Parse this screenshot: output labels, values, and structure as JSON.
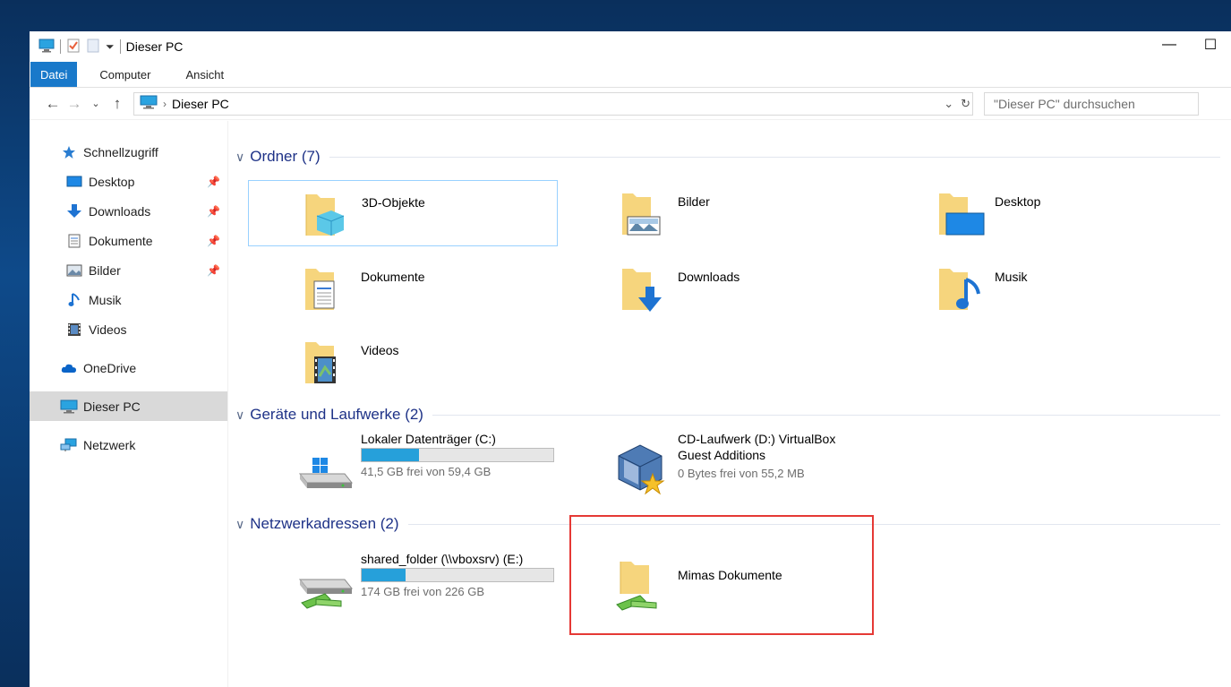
{
  "window": {
    "title": "Dieser PC",
    "controls": [
      "minimize",
      "maximize"
    ]
  },
  "ribbon": {
    "tabs": [
      {
        "label": "Datei"
      },
      {
        "label": "Computer"
      },
      {
        "label": "Ansicht"
      }
    ]
  },
  "address": {
    "crumb": "Dieser PC",
    "search_placeholder": "\"Dieser PC\" durchsuchen"
  },
  "sidebar": {
    "quick_access": "Schnellzugriff",
    "items": [
      {
        "label": "Desktop",
        "icon": "desktop-icon",
        "pinned": true
      },
      {
        "label": "Downloads",
        "icon": "download-icon",
        "pinned": true
      },
      {
        "label": "Dokumente",
        "icon": "document-icon",
        "pinned": true
      },
      {
        "label": "Bilder",
        "icon": "image-icon",
        "pinned": true
      },
      {
        "label": "Musik",
        "icon": "music-icon",
        "pinned": false
      },
      {
        "label": "Videos",
        "icon": "video-icon",
        "pinned": false
      }
    ],
    "onedrive": "OneDrive",
    "this_pc": "Dieser PC",
    "network": "Netzwerk"
  },
  "sections": {
    "folders_title": "Ordner (7)",
    "drives_title": "Geräte und Laufwerke (2)",
    "network_title": "Netzwerkadressen (2)"
  },
  "folders": [
    {
      "label": "3D-Objekte",
      "icon": "3d-objects-icon"
    },
    {
      "label": "Bilder",
      "icon": "pictures-folder-icon"
    },
    {
      "label": "Desktop",
      "icon": "desktop-folder-icon"
    },
    {
      "label": "Dokumente",
      "icon": "documents-folder-icon"
    },
    {
      "label": "Downloads",
      "icon": "downloads-folder-icon"
    },
    {
      "label": "Musik",
      "icon": "music-folder-icon"
    },
    {
      "label": "Videos",
      "icon": "videos-folder-icon"
    }
  ],
  "drives": [
    {
      "name": "Lokaler Datenträger (C:)",
      "free": "41,5 GB frei von 59,4 GB",
      "used_fraction": 0.3
    },
    {
      "name_line1": "CD-Laufwerk (D:) VirtualBox",
      "name_line2": "Guest Additions",
      "free": "0 Bytes frei von 55,2 MB"
    }
  ],
  "network": [
    {
      "name": "shared_folder (\\\\vboxsrv) (E:)",
      "free": "174 GB frei von 226 GB",
      "used_fraction": 0.23
    },
    {
      "name": "Mimas Dokumente"
    }
  ],
  "colors": {
    "accent": "#1979ca",
    "section_header": "#1e3287",
    "bar_fill": "#26a0da",
    "highlight": "#e53935",
    "folder": "#f6d57d"
  }
}
